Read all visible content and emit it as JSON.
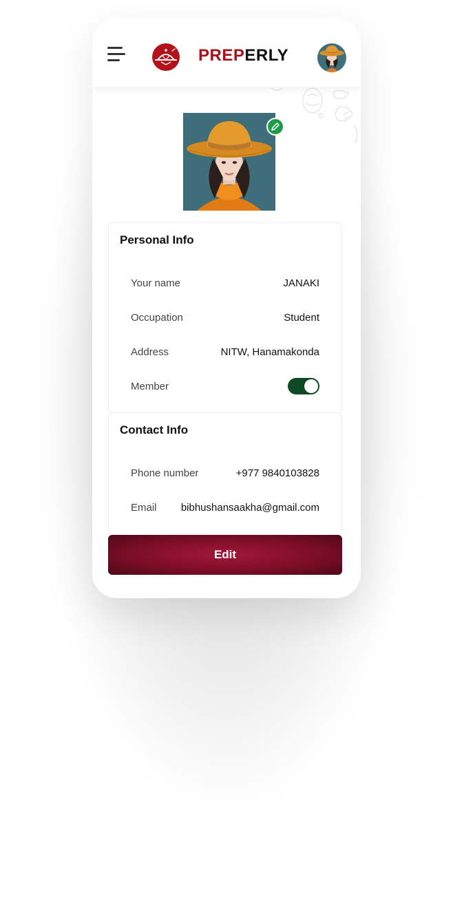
{
  "app": {
    "brand_part1": "PREP",
    "brand_part2": "ERLY",
    "brand_color": "#a8121d"
  },
  "header": {
    "menu_icon": "hamburger-menu-icon",
    "logo_icon": "cloche-logo-icon",
    "avatar_icon": "user-avatar"
  },
  "profile": {
    "photo_icon": "profile-photo",
    "edit_photo_icon": "pencil-icon"
  },
  "personal_info": {
    "title": "Personal Info",
    "fields": [
      {
        "label": "Your name",
        "value": "JANAKI"
      },
      {
        "label": "Occupation",
        "value": "Student"
      },
      {
        "label": "Address",
        "value": "NITW, Hanamakonda"
      }
    ],
    "member": {
      "label": "Member",
      "enabled": true
    }
  },
  "contact_info": {
    "title": "Contact Info",
    "fields": [
      {
        "label": "Phone number",
        "value": "+977 9840103828"
      },
      {
        "label": "Email",
        "value": "bibhushansaakha@gmail.com"
      }
    ]
  },
  "actions": {
    "edit_label": "Edit"
  },
  "colors": {
    "toggle_on": "#0b4a24",
    "edit_badge": "#1e9a4a",
    "button_gradient": "#8a102c"
  }
}
